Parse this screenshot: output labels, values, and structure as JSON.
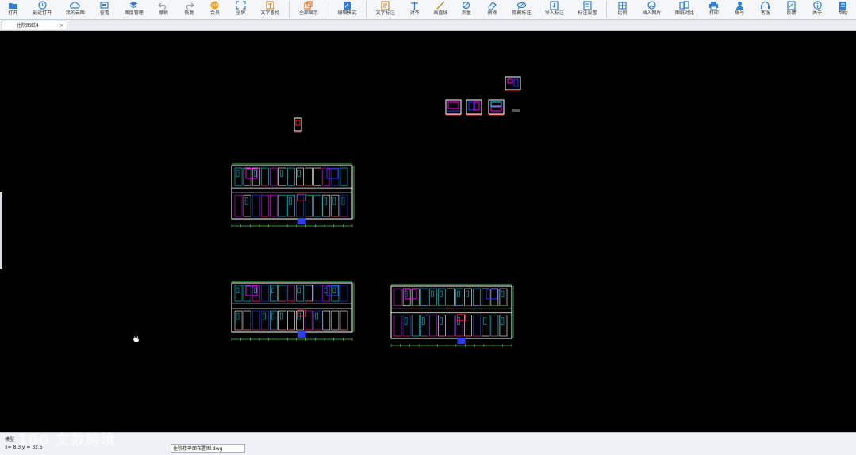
{
  "toolbar": {
    "items": [
      {
        "label": "打开",
        "icon": "folder-open-icon"
      },
      {
        "label": "最近打开",
        "icon": "recent-clock-icon"
      },
      {
        "label": "我的云图",
        "icon": "cloud-icon"
      },
      {
        "label": "查看",
        "icon": "view-icon"
      },
      {
        "label": "图层管理",
        "icon": "layers-icon"
      },
      {
        "label": "撤销",
        "icon": "undo-icon"
      },
      {
        "label": "恢复",
        "icon": "redo-icon"
      },
      {
        "label": "会员",
        "icon": "vip-icon"
      },
      {
        "label": "全屏",
        "icon": "fullscreen-icon"
      },
      {
        "label": "文字查找",
        "icon": "find-text-icon"
      },
      {
        "label": "全部显示",
        "icon": "zoom-all-icon"
      },
      {
        "label": "编辑模式",
        "icon": "edit-mode-icon"
      },
      {
        "label": "文字标注",
        "icon": "text-annotate-icon"
      },
      {
        "label": "对齐",
        "icon": "align-icon"
      },
      {
        "label": "画直线",
        "icon": "line-icon"
      },
      {
        "label": "测量",
        "icon": "measure-icon"
      },
      {
        "label": "删除",
        "icon": "eraser-icon"
      },
      {
        "label": "隐藏标注",
        "icon": "hide-annotation-icon"
      },
      {
        "label": "导入标注",
        "icon": "import-annotation-icon"
      },
      {
        "label": "标注设置",
        "icon": "annotation-settings-icon"
      },
      {
        "label": "比例",
        "icon": "scale-icon"
      },
      {
        "label": "插入图片",
        "icon": "insert-image-icon"
      },
      {
        "label": "图纸对比",
        "icon": "compare-icon"
      },
      {
        "label": "打印",
        "icon": "print-icon"
      },
      {
        "label": "账号",
        "icon": "account-icon"
      },
      {
        "label": "客服",
        "icon": "headset-icon"
      },
      {
        "label": "反馈",
        "icon": "feedback-icon"
      },
      {
        "label": "关于",
        "icon": "info-icon"
      },
      {
        "label": "帮助",
        "icon": "help-icon"
      }
    ]
  },
  "tab": {
    "title": "住院图纸4",
    "close": "×"
  },
  "status": {
    "mode": "模型",
    "coord": "x= 8.3  y = 32.5",
    "file": "住院楼平面布置图.dwg"
  },
  "watermark": "100 文数跨境",
  "colors": {
    "canvas": "#000000",
    "wall": "#ffffff",
    "red": "#ff2020",
    "magenta": "#ff00ff",
    "blue": "#2a3cff",
    "cyan": "#00e5ff",
    "green": "#38d13f",
    "yellow": "#ffee00"
  }
}
